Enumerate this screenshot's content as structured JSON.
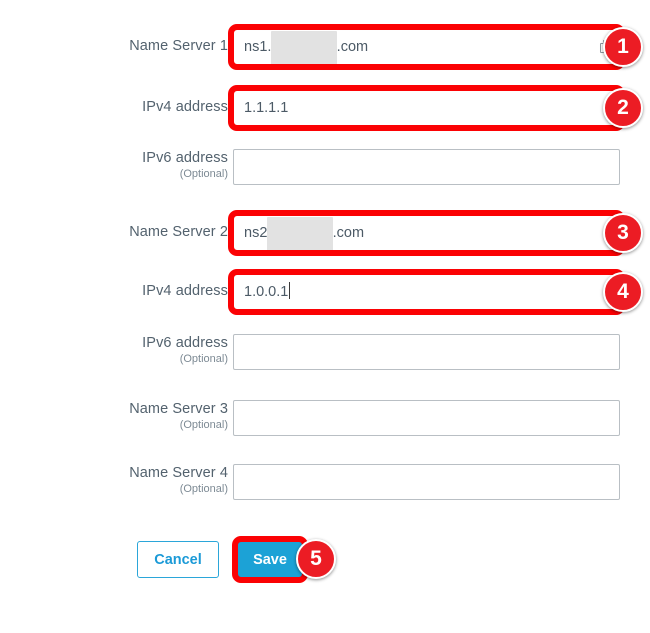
{
  "form": {
    "rows": [
      {
        "id": "name-server-1",
        "label": "Name Server 1",
        "optional_note": "",
        "value_prefix": "ns1.",
        "value_redacted": "xxxxxxxxx",
        "value_suffix": ".com",
        "placeholder": "",
        "has_copy_icon": true,
        "has_caret": false,
        "highlighted": true
      },
      {
        "id": "ipv4-address-1",
        "label": "IPv4 address",
        "optional_note": "",
        "value": "1.1.1.1",
        "placeholder": "",
        "has_copy_icon": false,
        "has_caret": false,
        "highlighted": true
      },
      {
        "id": "ipv6-address-1",
        "label": "IPv6 address",
        "optional_note": "(Optional)",
        "value": "",
        "placeholder": "",
        "has_copy_icon": false,
        "has_caret": false,
        "highlighted": false
      },
      {
        "id": "name-server-2",
        "label": "Name Server 2",
        "optional_note": "",
        "value_prefix": "ns2",
        "value_redacted": "xxxxxxxxx",
        "value_suffix": ".com",
        "placeholder": "",
        "has_copy_icon": false,
        "has_caret": false,
        "highlighted": true
      },
      {
        "id": "ipv4-address-2",
        "label": "IPv4 address",
        "optional_note": "",
        "value": "1.0.0.1",
        "placeholder": "",
        "has_copy_icon": false,
        "has_caret": true,
        "highlighted": true
      },
      {
        "id": "ipv6-address-2",
        "label": "IPv6 address",
        "optional_note": "(Optional)",
        "value": "",
        "placeholder": "",
        "has_copy_icon": false,
        "has_caret": false,
        "highlighted": false
      },
      {
        "id": "name-server-3",
        "label": "Name Server 3",
        "optional_note": "(Optional)",
        "value": "",
        "placeholder": "",
        "has_copy_icon": false,
        "has_caret": false,
        "highlighted": false
      },
      {
        "id": "name-server-4",
        "label": "Name Server 4",
        "optional_note": "(Optional)",
        "value": "",
        "placeholder": "",
        "has_copy_icon": false,
        "has_caret": false,
        "highlighted": false
      }
    ]
  },
  "buttons": {
    "cancel_label": "Cancel",
    "save_label": "Save"
  },
  "annotations": {
    "badges": [
      {
        "number": "1",
        "target": "name-server-1"
      },
      {
        "number": "2",
        "target": "ipv4-address-1"
      },
      {
        "number": "3",
        "target": "name-server-2"
      },
      {
        "number": "4",
        "target": "ipv4-address-2"
      },
      {
        "number": "5",
        "target": "save-button"
      }
    ]
  },
  "colors": {
    "annotation_red": "#ec1c24",
    "highlight_red": "#fb0204",
    "accent_blue": "#1ca2d6",
    "label_gray": "#53626e",
    "border_gray": "#b9bfc4",
    "redaction_gray": "#e2e2e2"
  },
  "icons": {
    "copy": "copy-icon"
  }
}
